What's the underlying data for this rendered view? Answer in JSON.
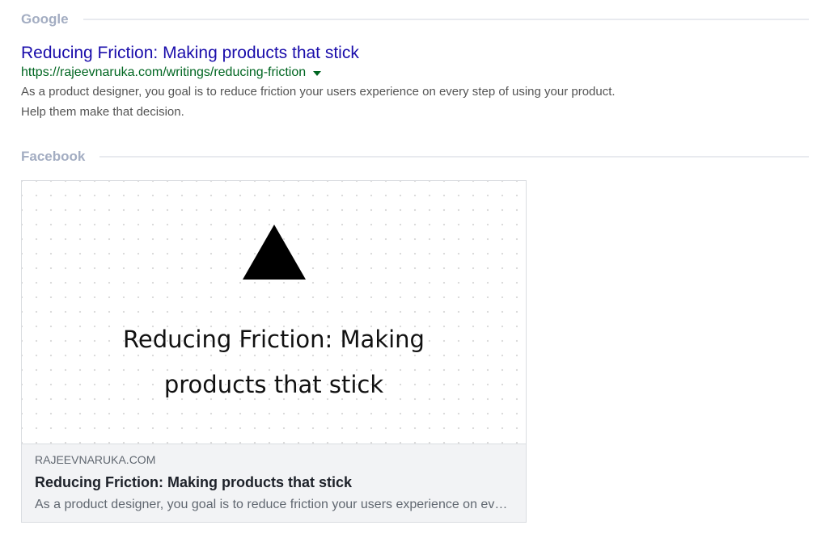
{
  "google": {
    "section_label": "Google",
    "title": "Reducing Friction: Making products that stick",
    "url": "https://rajeevnaruka.com/writings/reducing-friction",
    "description": "As a product designer, you goal is to reduce friction your users experience on every step of using your product. Help them make that decision.",
    "colors": {
      "title": "#1a0dab",
      "url": "#006621",
      "description": "#545454"
    }
  },
  "facebook": {
    "section_label": "Facebook",
    "image": {
      "icon": "triangle-logo-icon",
      "title": "Reducing Friction: Making products that stick"
    },
    "domain": "RAJEEVNARUKA.COM",
    "title": "Reducing Friction: Making products that stick",
    "description": "As a product designer, you goal is to reduce friction your users experience on every step of using your product. Help them make that decision.",
    "colors": {
      "meta_background": "#f2f3f5",
      "title": "#1d2129",
      "muted": "#606770"
    }
  },
  "theme": {
    "section_label_color": "#a3adc2",
    "rule_color": "#e8eaef"
  }
}
